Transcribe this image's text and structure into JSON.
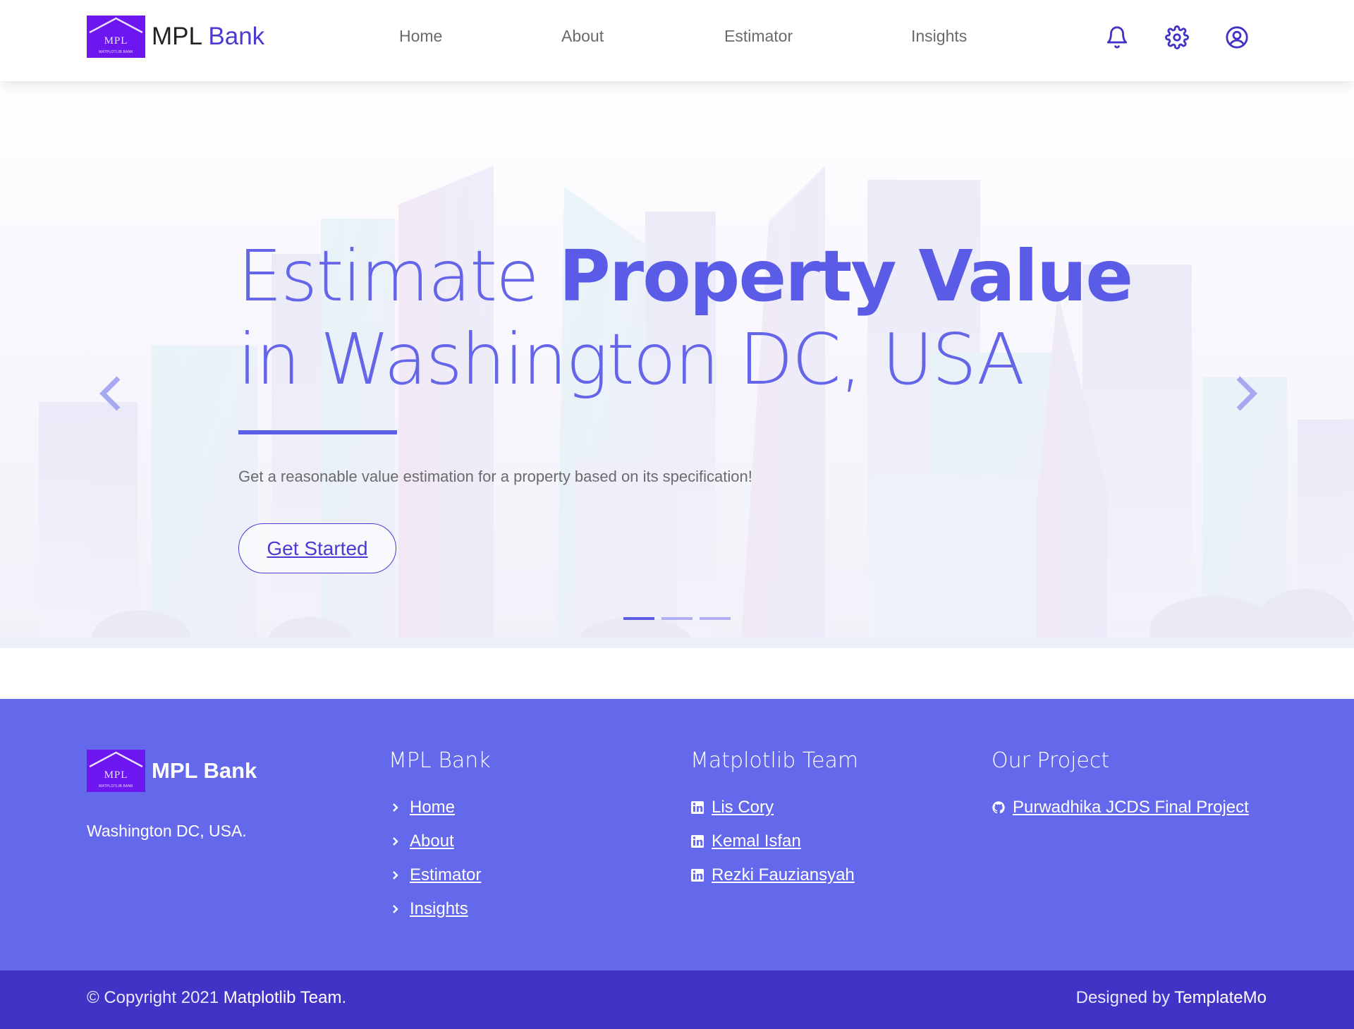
{
  "header": {
    "brand_prefix": "MPL",
    "brand_accent": "Bank",
    "logo_text": "MPL",
    "logo_subtext": "MATPLOTLIB BANK",
    "nav": {
      "home": "Home",
      "about": "About",
      "estimator": "Estimator",
      "insights": "Insights"
    },
    "icons": [
      "bell-icon",
      "gear-icon",
      "user-icon"
    ]
  },
  "hero": {
    "title_part1": "Estimate ",
    "title_bold": "Property Value",
    "title_part2": " in Washington DC, USA",
    "subtitle": "Get a reasonable value estimation for a property based on its specification!",
    "cta_label": "Get Started",
    "slides": 3,
    "active_slide": 1
  },
  "footer": {
    "brand_name": "MPL Bank",
    "logo_text": "MPL",
    "logo_subtext": "MATPLOTLIB BANK",
    "address": "Washington DC, USA.",
    "col1": {
      "title": "MPL Bank",
      "links": [
        "Home",
        "About",
        "Estimator",
        "Insights"
      ]
    },
    "col2": {
      "title": "Matplotlib Team",
      "members": [
        "Lis Cory",
        "Kemal Isfan",
        "Rezki Fauziansyah"
      ]
    },
    "col3": {
      "title": "Our Project",
      "project": "Purwadhika JCDS Final Project"
    }
  },
  "bottom": {
    "copyright_prefix": "© Copyright 2021 ",
    "copyright_owner": "Matplotlib Team",
    "copyright_suffix": ".",
    "designed_prefix": "Designed by ",
    "designed_by": "TemplateMo"
  },
  "colors": {
    "accent": "#5c5ee8",
    "brand": "#4b3bd1",
    "footer": "#6468ea",
    "bottom_bar": "#4133c5",
    "logo": "#6d16f0"
  }
}
